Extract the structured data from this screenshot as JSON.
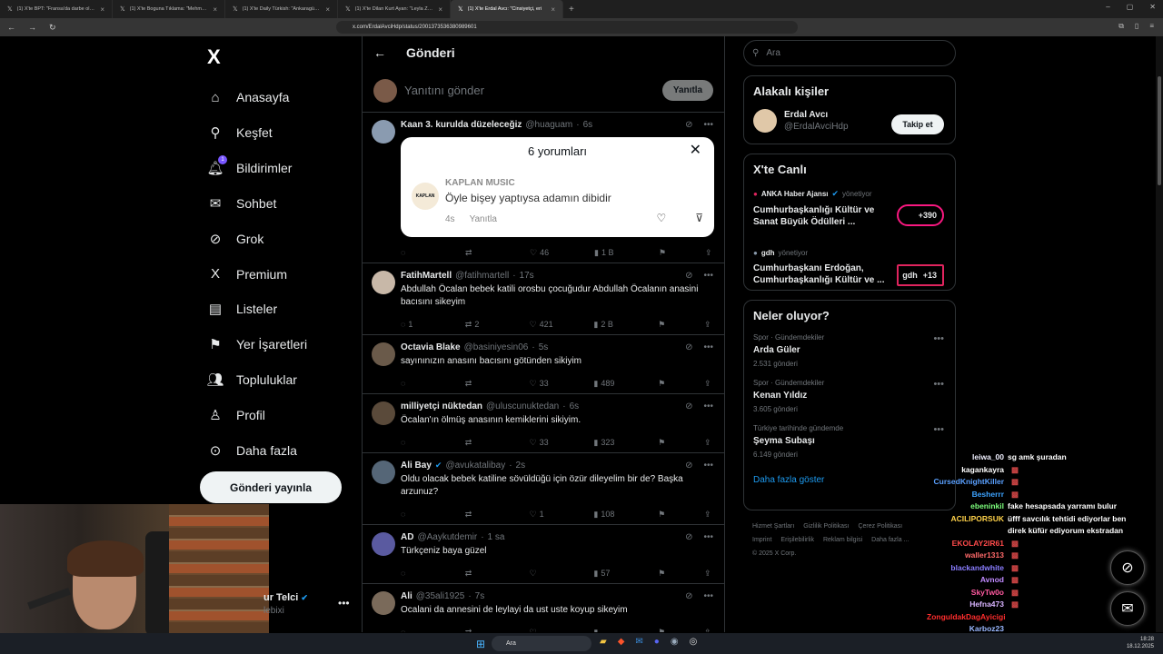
{
  "browser": {
    "tabs": [
      {
        "title": "(1) X'te BPT: \"Fransa'da darbe olduğu",
        "active": false
      },
      {
        "title": "(1) X'te Boguna Tıklama: \"Mehmet Ali",
        "active": false
      },
      {
        "title": "(1) X'te Daily Türkish: \"Ankaragücü te",
        "active": false
      },
      {
        "title": "(1) X'te Dilan Kurt Ayan: \"Leyla Zana",
        "active": false
      },
      {
        "title": "(1) X'te Erdal Avcı: \"Cinsiyetçi, eri",
        "active": true
      }
    ],
    "url": "x.com/ErdalAvciHdp/status/2001373536380989601"
  },
  "nav": {
    "logo": "X",
    "items": [
      {
        "label": "Anasayfa",
        "icon": "home-icon",
        "glyph": "⌂"
      },
      {
        "label": "Keşfet",
        "icon": "search-icon",
        "glyph": "⚲"
      },
      {
        "label": "Bildirimler",
        "icon": "bell-icon",
        "glyph": "🔔︎",
        "badge": "1"
      },
      {
        "label": "Sohbet",
        "icon": "envelope-icon",
        "glyph": "✉"
      },
      {
        "label": "Grok",
        "icon": "grok-icon",
        "glyph": "⊘"
      },
      {
        "label": "Premium",
        "icon": "x-premium-icon",
        "glyph": "X"
      },
      {
        "label": "Listeler",
        "icon": "list-icon",
        "glyph": "▤"
      },
      {
        "label": "Yer İşaretleri",
        "icon": "bookmark-icon",
        "glyph": "⚑"
      },
      {
        "label": "Topluluklar",
        "icon": "communities-icon",
        "glyph": "👥︎"
      },
      {
        "label": "Profil",
        "icon": "profile-icon",
        "glyph": "♙"
      },
      {
        "label": "Daha fazla",
        "icon": "more-circle-icon",
        "glyph": "⊙"
      }
    ],
    "post_button": "Gönderi yayınla",
    "account_name": "ur Telci",
    "account_handle": "lebixi"
  },
  "center": {
    "header": "Gönderi",
    "reply_placeholder": "Yanıtını gönder",
    "reply_button": "Yanıtla",
    "popup": {
      "title": "6 yorumları",
      "logo_text": "KAPLAN",
      "author": "KAPLAN MUSIC",
      "message": "Öyle bişey yaptıysa adamın dibidir",
      "time": "4s",
      "reply": "Yanıtla"
    },
    "tweets": [
      {
        "name": "Kaan 3. kurulda düzeleceğiz",
        "handle": "@huaguam",
        "time": "6s",
        "verified": false,
        "text": "",
        "replies": "",
        "retweets": "",
        "likes": "46",
        "views": "1 B"
      },
      {
        "name": "FatihMartell",
        "handle": "@fatihmartell",
        "time": "17s",
        "verified": false,
        "text": "Abdullah Öcalan bebek katili orosbu çocuğudur Abdullah Öcalanın anasini bacısını sikeyim",
        "replies": "1",
        "retweets": "2",
        "likes": "421",
        "views": "2 B"
      },
      {
        "name": "Octavia Blake",
        "handle": "@basiniyesin06",
        "time": "5s",
        "verified": false,
        "text": "sayınınızın anasını bacısını götünden sikiyim",
        "replies": "",
        "retweets": "",
        "likes": "33",
        "views": "489"
      },
      {
        "name": "milliyetçi nüktedan",
        "handle": "@uluscunuktedan",
        "time": "6s",
        "verified": false,
        "text": "Öcalan'ın ölmüş anasının kemiklerini sikiyim.",
        "replies": "",
        "retweets": "",
        "likes": "33",
        "views": "323"
      },
      {
        "name": "Ali Bay",
        "handle": "@avukatalibay",
        "time": "2s",
        "verified": true,
        "text": "Oldu olacak bebek katiline sövüldüğü için özür dileyelim bir de? Başka arzunuz?",
        "replies": "",
        "retweets": "",
        "likes": "1",
        "views": "108"
      },
      {
        "name": "AD",
        "handle": "@Aaykutdemir",
        "time": "1 sa",
        "verified": false,
        "text": "Türkçeniz baya güzel",
        "replies": "",
        "retweets": "",
        "likes": "",
        "views": "57"
      },
      {
        "name": "Ali",
        "handle": "@35ali1925",
        "time": "7s",
        "verified": false,
        "text": "Ocalani da annesini de leylayi da ust uste koyup sikeyim",
        "replies": "",
        "retweets": "",
        "likes": "",
        "views": ""
      }
    ]
  },
  "right": {
    "search_placeholder": "Ara",
    "related_title": "Alakalı kişiler",
    "related_name": "Erdal Avcı",
    "related_handle": "@ErdalAvciHdp",
    "follow": "Takip et",
    "live_title": "X'te Canlı",
    "live": [
      {
        "host": "ANKA Haber Ajansı",
        "status": "yönetiyor",
        "title": "Cumhurbaşkanlığı Kültür ve Sanat Büyük Ödülleri ...",
        "count": "+390"
      },
      {
        "host": "gdh",
        "status": "yönetiyor",
        "title": "Cumhurbaşkanı Erdoğan, Cumhurbaşkanlığı Kültür ve ...",
        "count": "+13",
        "thumb": "gdh"
      }
    ],
    "trends_title": "Neler oluyor?",
    "trends": [
      {
        "category": "Spor · Gündemdekiler",
        "name": "Arda Güler",
        "posts": "2.531 gönderi"
      },
      {
        "category": "Spor · Gündemdekiler",
        "name": "Kenan Yıldız",
        "posts": "3.605 gönderi"
      },
      {
        "category": "Türkiye tarihinde gündemde",
        "name": "Şeyma Subaşı",
        "posts": "6.149 gönderi"
      }
    ],
    "show_more": "Daha fazla göster",
    "footer": [
      "Hizmet Şartları",
      "Gizlilik Politikası",
      "Çerez Politikası",
      "Imprint",
      "Erişilebilirlik",
      "Reklam bilgisi",
      "Daha fazla ...",
      "© 2025 X Corp."
    ]
  },
  "chat": [
    {
      "user": "leiwa_00",
      "msg": "sg amk şuradan",
      "color": "#f0f0ff"
    },
    {
      "user": "kagankayra",
      "msg": "",
      "color": "#ffffff"
    },
    {
      "user": "CursedKnightKiller",
      "msg": "",
      "color": "#5aa0ff"
    },
    {
      "user": "Besherrr",
      "msg": "",
      "color": "#3da3ff"
    },
    {
      "user": "ebeninkil",
      "msg": "fake hesapsada yarramı bulur",
      "color": "#7dff7d"
    },
    {
      "user": "ACILIPORSUK",
      "msg": "üfff savcılık tehtidi ediyorlar ben direk küfür ediyorum ekstradan",
      "color": "#ffd24a"
    },
    {
      "user": "EKOLAY2IR61",
      "msg": "",
      "color": "#ff4b4b"
    },
    {
      "user": "waller1313",
      "msg": "",
      "color": "#ff6a6a"
    },
    {
      "user": "blackandwhite",
      "msg": "",
      "color": "#8a7dff"
    },
    {
      "user": "Avnod",
      "msg": "",
      "color": "#c08aff"
    },
    {
      "user": "SkyTw0o",
      "msg": "",
      "color": "#ff5aa0"
    },
    {
      "user": "Hefna473",
      "msg": "",
      "color": "#d8b4ff"
    },
    {
      "user": "ZonguldakDagAyicigi",
      "msg": "",
      "color": "#ff2d2d"
    },
    {
      "user": "Karboz23",
      "msg": "",
      "color": "#9ab8ff"
    }
  ],
  "taskbar": {
    "search": "Ara",
    "time": "18:28",
    "date": "18.12.2025"
  }
}
